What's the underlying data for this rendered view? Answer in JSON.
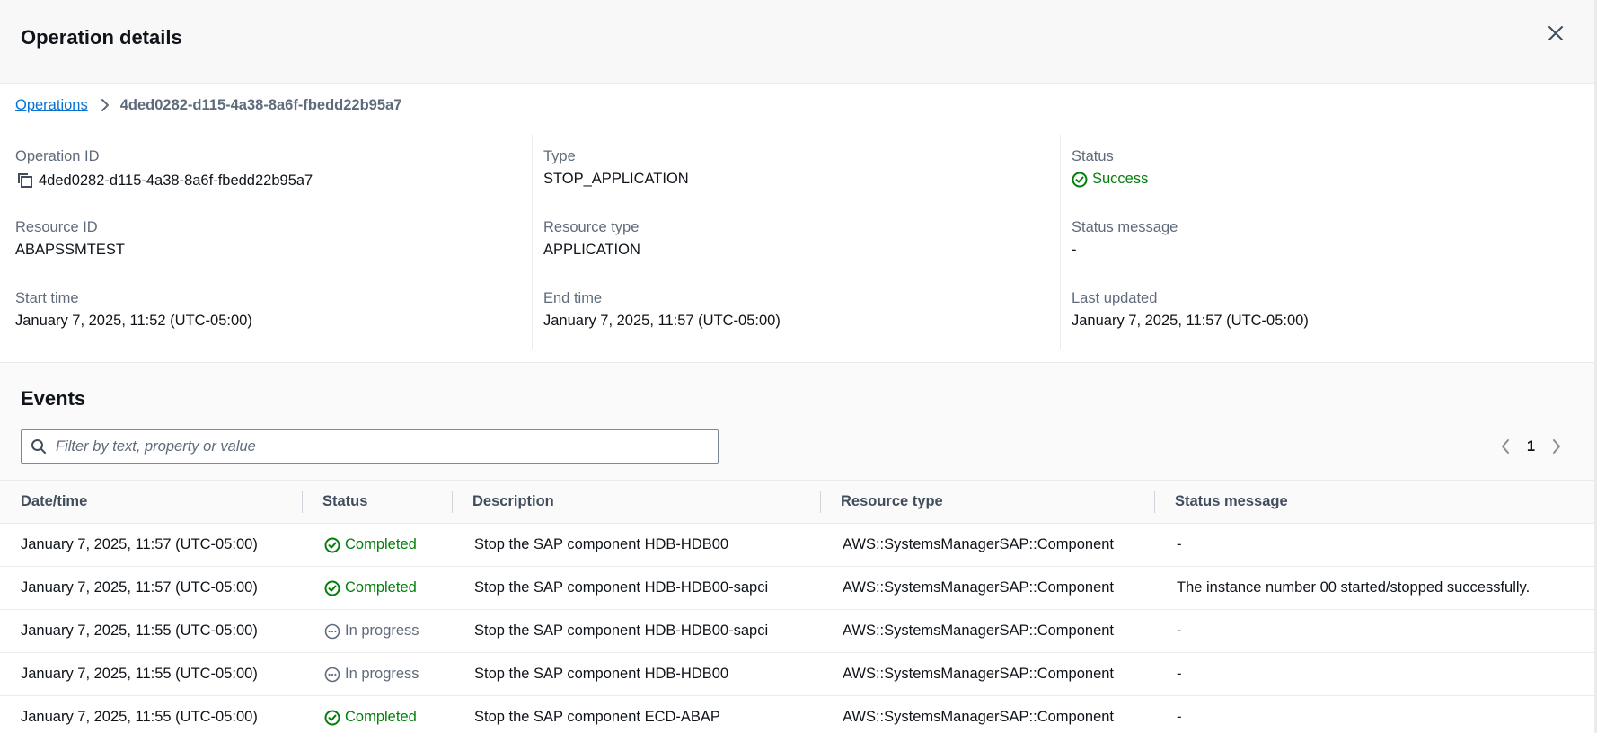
{
  "header": {
    "title": "Operation details",
    "close_icon": "close-icon"
  },
  "breadcrumb": {
    "parent": "Operations",
    "current": "4ded0282-d115-4a38-8a6f-fbedd22b95a7"
  },
  "details": {
    "operation_id": {
      "label": "Operation ID",
      "value": "4ded0282-d115-4a38-8a6f-fbedd22b95a7"
    },
    "type": {
      "label": "Type",
      "value": "STOP_APPLICATION"
    },
    "status": {
      "label": "Status",
      "value": "Success",
      "color": "#037f0c"
    },
    "resource_id": {
      "label": "Resource ID",
      "value": "ABAPSSMTEST"
    },
    "resource_type": {
      "label": "Resource type",
      "value": "APPLICATION"
    },
    "status_message": {
      "label": "Status message",
      "value": "-"
    },
    "start_time": {
      "label": "Start time",
      "value": "January 7, 2025, 11:52 (UTC-05:00)"
    },
    "end_time": {
      "label": "End time",
      "value": "January 7, 2025, 11:57 (UTC-05:00)"
    },
    "last_updated": {
      "label": "Last updated",
      "value": "January 7, 2025, 11:57 (UTC-05:00)"
    }
  },
  "events": {
    "title": "Events",
    "filter_placeholder": "Filter by text, property or value",
    "current_page": "1",
    "columns": [
      "Date/time",
      "Status",
      "Description",
      "Resource type",
      "Status message"
    ],
    "rows": [
      {
        "datetime": "January 7, 2025, 11:57 (UTC-05:00)",
        "status": "Completed",
        "description": "Stop the SAP component HDB-HDB00",
        "resource_type": "AWS::SystemsManagerSAP::Component",
        "status_message": "-"
      },
      {
        "datetime": "January 7, 2025, 11:57 (UTC-05:00)",
        "status": "Completed",
        "description": "Stop the SAP component HDB-HDB00-sapci",
        "resource_type": "AWS::SystemsManagerSAP::Component",
        "status_message": "The instance number 00 started/stopped successfully."
      },
      {
        "datetime": "January 7, 2025, 11:55 (UTC-05:00)",
        "status": "In progress",
        "description": "Stop the SAP component HDB-HDB00-sapci",
        "resource_type": "AWS::SystemsManagerSAP::Component",
        "status_message": "-"
      },
      {
        "datetime": "January 7, 2025, 11:55 (UTC-05:00)",
        "status": "In progress",
        "description": "Stop the SAP component HDB-HDB00",
        "resource_type": "AWS::SystemsManagerSAP::Component",
        "status_message": "-"
      },
      {
        "datetime": "January 7, 2025, 11:55 (UTC-05:00)",
        "status": "Completed",
        "description": "Stop the SAP component ECD-ABAP",
        "resource_type": "AWS::SystemsManagerSAP::Component",
        "status_message": "-"
      }
    ]
  },
  "colors": {
    "link": "#0972d3",
    "success": "#037f0c",
    "muted": "#5f6b7a"
  }
}
